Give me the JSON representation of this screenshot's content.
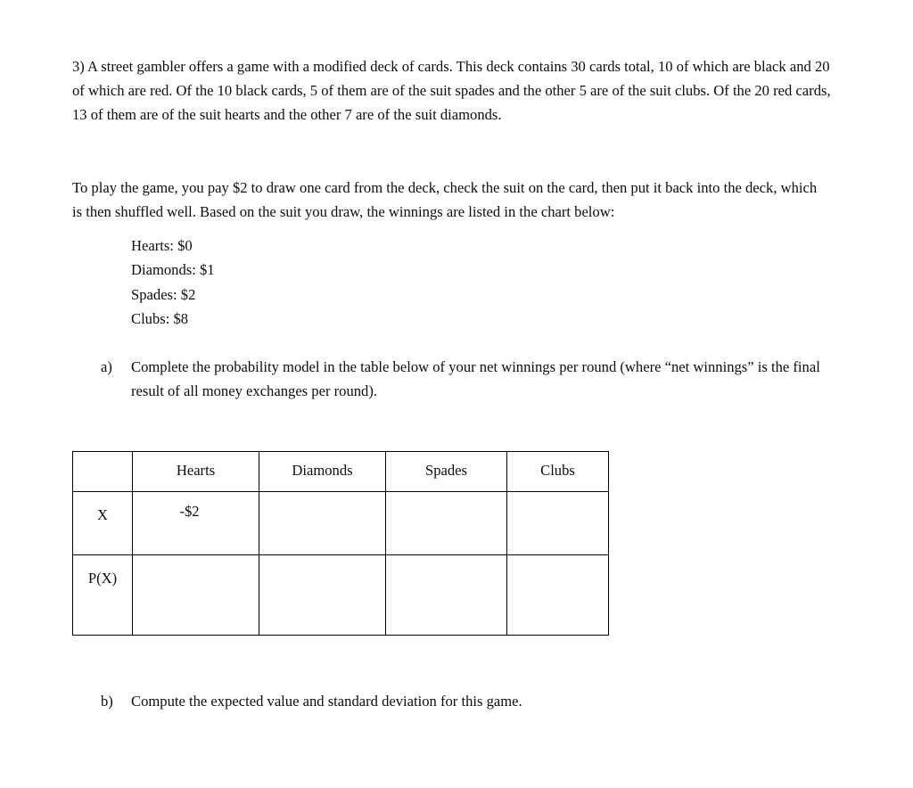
{
  "document": {
    "question_number": "3)",
    "intro_paragraph": "3) A street gambler offers a game with a modified deck of cards. This deck contains 30 cards total, 10 of which are black and 20 of which are red. Of the 10 black cards, 5 of them are of the suit spades and the other 5 are of the suit clubs. Of the 20 red cards, 13 of them are of the suit hearts and the other 7 are of the suit diamonds.",
    "play_paragraph": "To play the game, you pay $2 to draw one card from the deck, check the suit on the card, then put it back into the deck, which is then shuffled well. Based on the suit you draw, the winnings are listed in the chart below:",
    "winnings": [
      {
        "suit": "Hearts",
        "label": "Hearts: $0",
        "amount": "$0"
      },
      {
        "suit": "Diamonds",
        "label": "Diamonds: $1",
        "amount": "$1"
      },
      {
        "suit": "Spades",
        "label": "Spades: $2",
        "amount": "$2"
      },
      {
        "suit": "Clubs",
        "label": "Clubs: $8",
        "amount": "$8"
      }
    ],
    "parts": [
      {
        "marker": "a)",
        "text": "Complete the probability model in the table below of your net winnings per round (where “net winnings” is the final result of all money exchanges per round)."
      },
      {
        "marker": "b)",
        "text": "Compute the expected value and standard deviation for this game."
      }
    ],
    "table": {
      "corner_label": "",
      "columns": [
        "Hearts",
        "Diamonds",
        "Spades",
        "Clubs"
      ],
      "rows": [
        {
          "label": "X",
          "cells": [
            "-$2",
            "",
            "",
            ""
          ]
        },
        {
          "label": "P(X)",
          "cells": [
            "",
            "",
            "",
            ""
          ]
        }
      ]
    }
  }
}
